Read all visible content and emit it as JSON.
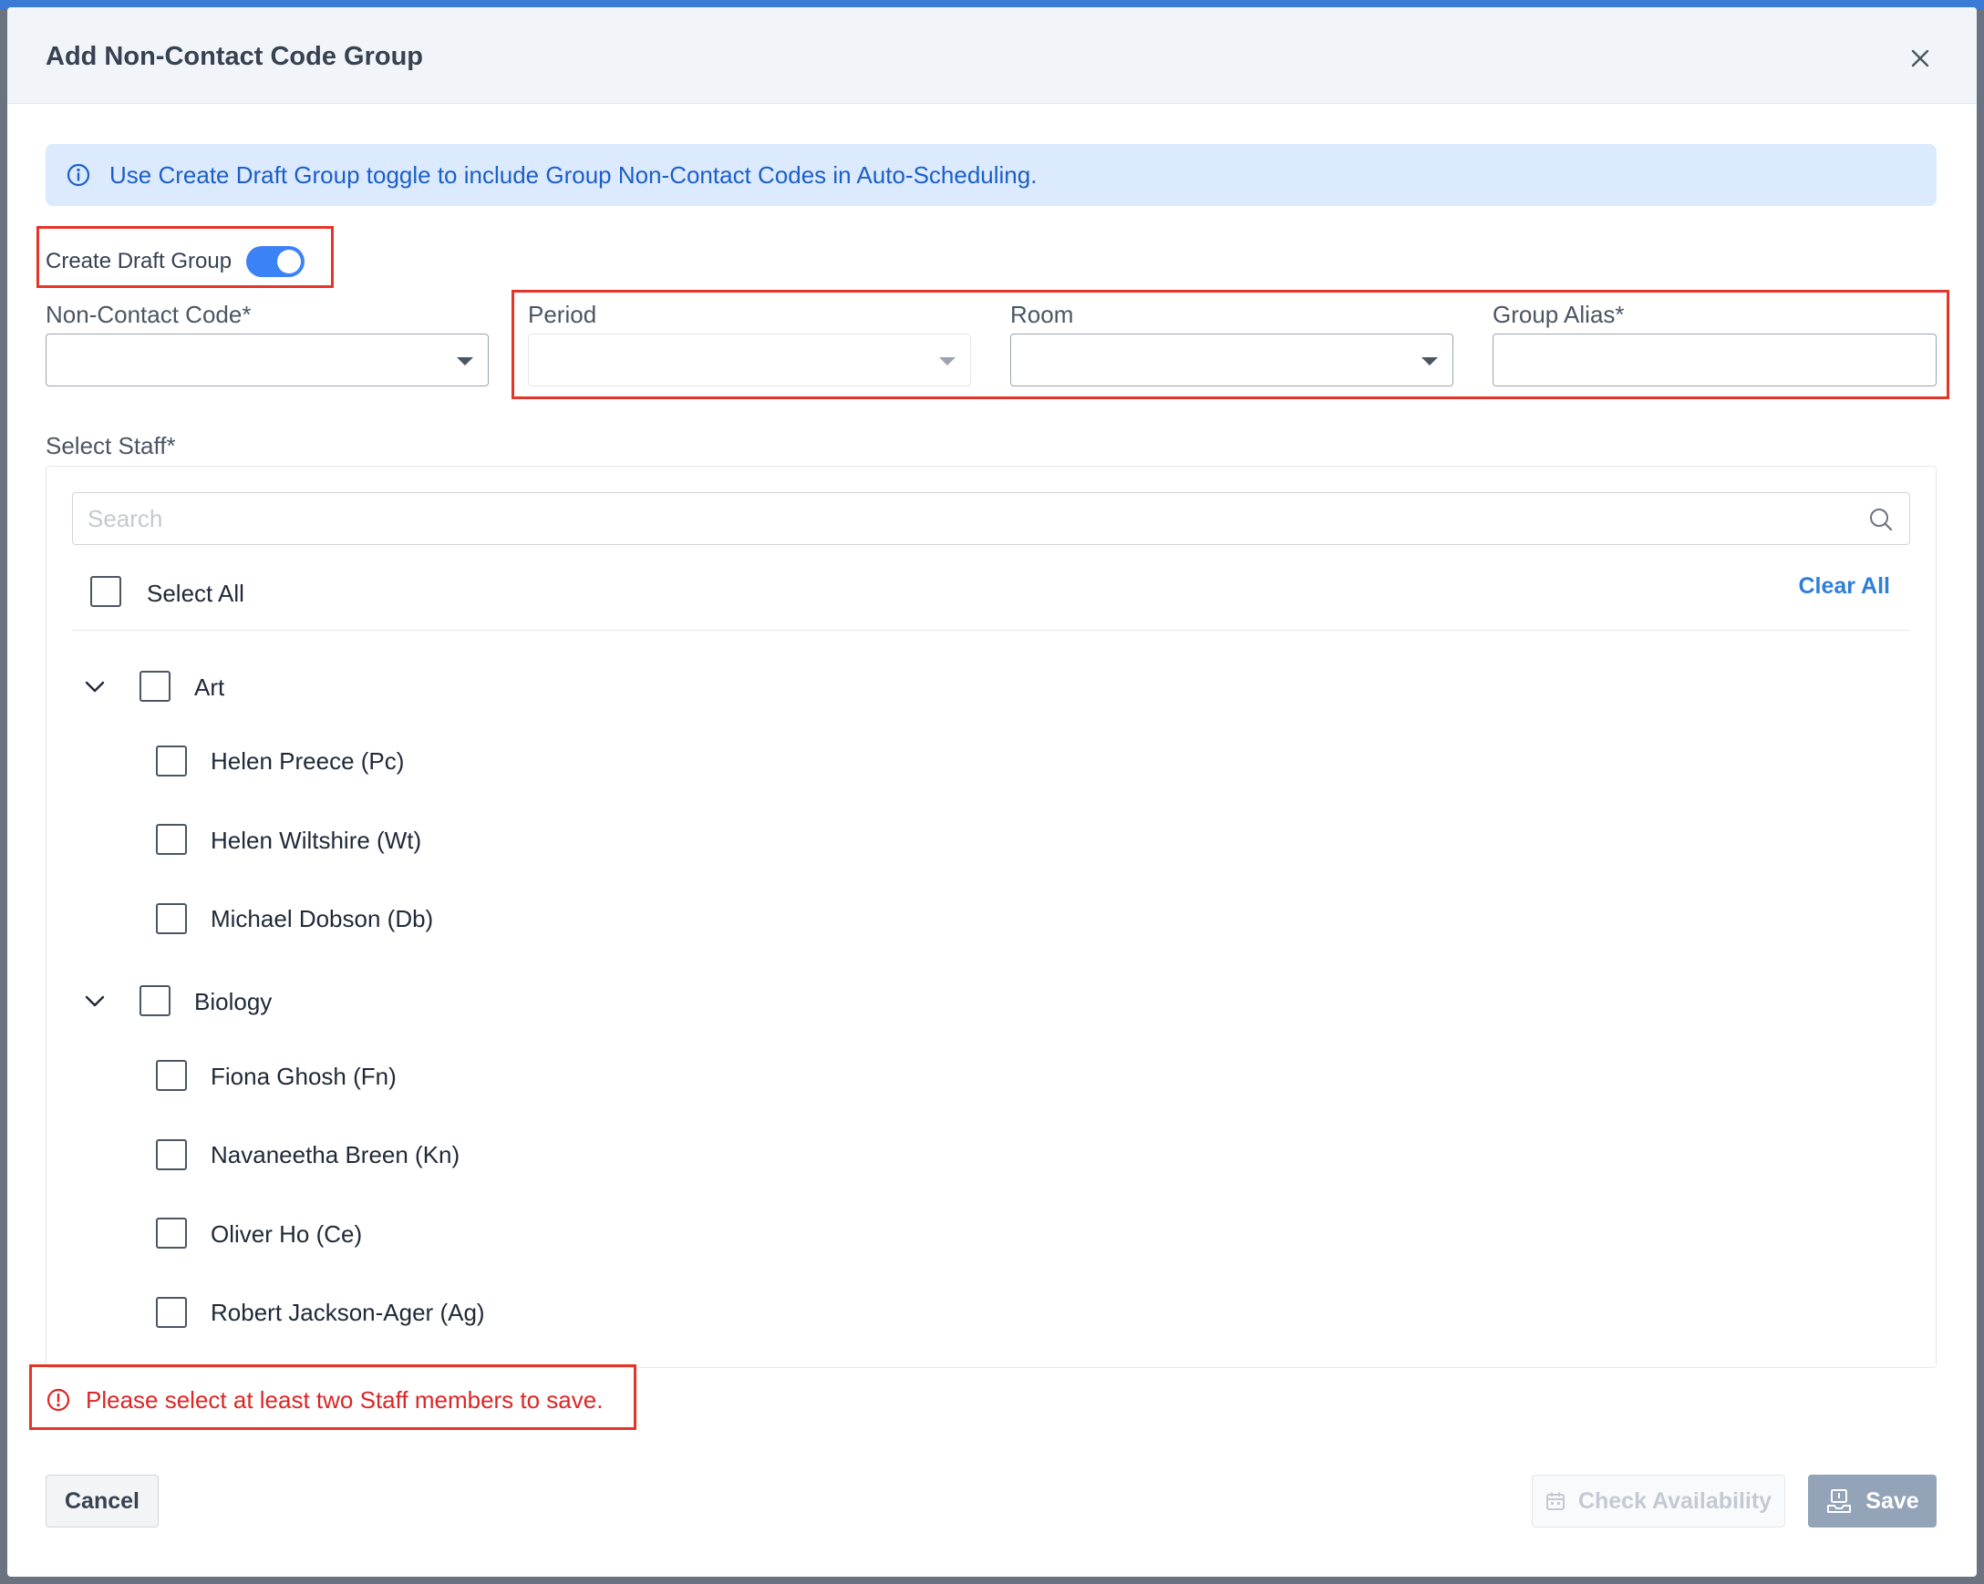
{
  "dialog": {
    "title": "Add Non-Contact Code Group"
  },
  "info_banner": {
    "text": "Use Create Draft Group toggle to include Group Non-Contact Codes in Auto-Scheduling."
  },
  "draft_toggle": {
    "label": "Create Draft Group",
    "on": true
  },
  "fields": {
    "non_contact_code": {
      "label": "Non-Contact Code*",
      "value": ""
    },
    "period": {
      "label": "Period",
      "value": ""
    },
    "room": {
      "label": "Room",
      "value": ""
    },
    "group_alias": {
      "label": "Group Alias*",
      "value": ""
    }
  },
  "staff": {
    "label": "Select Staff*",
    "search_placeholder": "Search",
    "select_all_label": "Select All",
    "clear_all_label": "Clear All",
    "groups": [
      {
        "name": "Art",
        "members": [
          "Helen Preece (Pc)",
          "Helen Wiltshire (Wt)",
          "Michael Dobson (Db)"
        ]
      },
      {
        "name": "Biology",
        "members": [
          "Fiona Ghosh (Fn)",
          "Navaneetha Breen (Kn)",
          "Oliver Ho (Ce)",
          "Robert Jackson-Ager (Ag)"
        ]
      }
    ]
  },
  "error": {
    "text": "Please select at least two Staff members to save."
  },
  "footer": {
    "cancel_label": "Cancel",
    "check_label": "Check Availability",
    "save_label": "Save"
  },
  "colors": {
    "accent": "#3b82f6",
    "link": "#2f7ed8",
    "error": "#dc2626",
    "annotation": "#e53526",
    "banner_bg": "#dbeafe"
  }
}
